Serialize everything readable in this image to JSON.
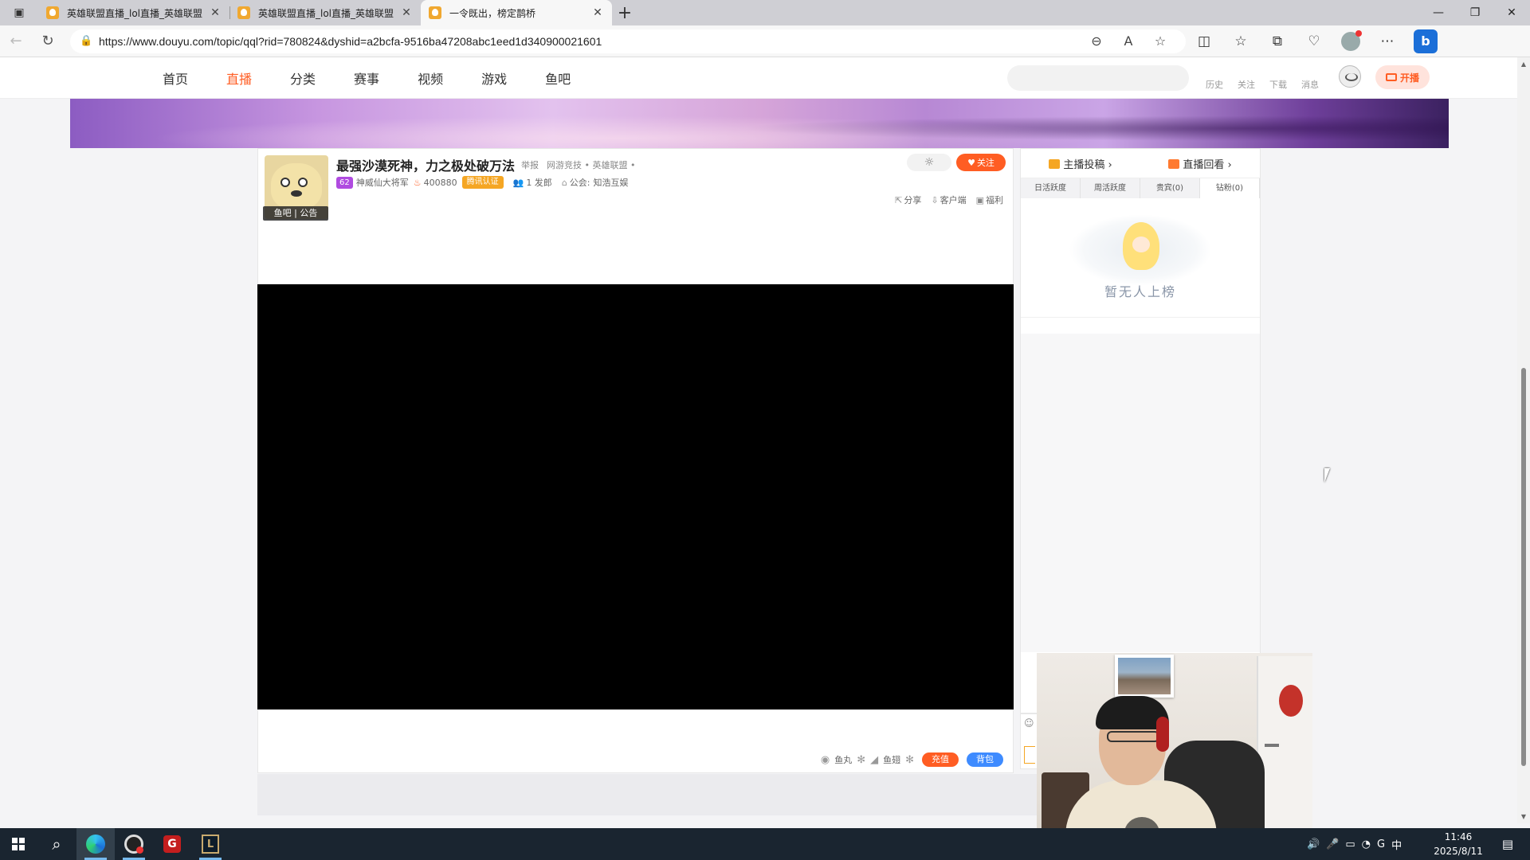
{
  "browser": {
    "tabs": [
      {
        "title": "英雄联盟直播_lol直播_英雄联盟"
      },
      {
        "title": "英雄联盟直播_lol直播_英雄联盟"
      },
      {
        "title": "一令既出，榜定鹊桥"
      }
    ],
    "url": "https://www.douyu.com/topic/qql?rid=780824&dyshid=a2bcfa-9516ba47208abc1eed1d340900021601"
  },
  "site": {
    "nav": [
      "首页",
      "直播",
      "分类",
      "赛事",
      "视频",
      "游戏",
      "鱼吧"
    ],
    "active_nav": "直播",
    "header_links": [
      "历史",
      "关注",
      "下载",
      "消息"
    ],
    "start_live": "开播"
  },
  "room": {
    "avatar_tag": "鱼吧 | 公告",
    "title": "最强沙漠死神，力之极处破万法",
    "report": "举报",
    "category": "网游竞技 • 英雄联盟 •",
    "level": "62",
    "anchor_name": "神威仙大将军",
    "hot": "400880",
    "certification": "腾讯认证",
    "fans": "1 发郎",
    "guild_label": "公会:",
    "guild": "知浩互娱",
    "follow": "关注",
    "actions": [
      "分享",
      "客户端",
      "福利"
    ],
    "gifts": {
      "fish_ball": "鱼丸",
      "fish_fin": "鱼翅",
      "recharge": "充值",
      "backpack": "背包"
    }
  },
  "side": {
    "links": [
      "主播投稿 ›",
      "直播回看 ›"
    ],
    "rank_tabs": [
      "日活跃度",
      "周活跃度",
      "贵宾(0)",
      "钻粉(0)"
    ],
    "active_rank_tab": "钻粉(0)",
    "empty_text": "暂无人上榜"
  },
  "taskbar": {
    "ime": "中",
    "time": "11:46",
    "date": "2025/8/11"
  }
}
